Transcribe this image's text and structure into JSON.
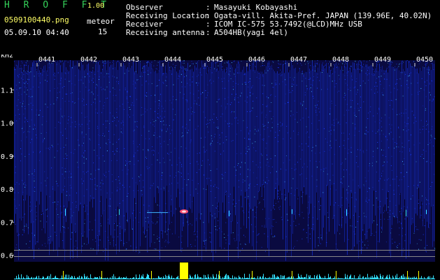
{
  "header": {
    "title": "H R O F F T",
    "version": "1.00",
    "filename": "0509100440.png",
    "datetime": "05.09.10 04:40",
    "meteor_label": "meteor",
    "meteor_count": "15"
  },
  "info": [
    {
      "key": "Observer",
      "value": "Masayuki Kobayashi"
    },
    {
      "key": "Receiving Location",
      "value": "Ogata-vill. Akita-Pref. JAPAN (139.96E, 40.02N)"
    },
    {
      "key": "Receiver",
      "value": "ICOM IC-575 53.7492(@LCD)MHz USB"
    },
    {
      "key": "Receiving antenna",
      "value": "A504HB(yagi 4el)"
    }
  ],
  "spectrogram": {
    "y_unit": "kHz",
    "y_ticks": [
      "1.1",
      "1.0",
      "0.9",
      "0.8",
      "0.7",
      "0.6"
    ],
    "y_values": [
      1.1,
      1.0,
      0.9,
      0.8,
      0.7,
      0.6
    ],
    "time_labels": [
      "0441",
      "0442",
      "0443",
      "0444",
      "0445",
      "0446",
      "0447",
      "0448",
      "0449",
      "0450"
    ],
    "colors": {
      "background": "#0a0a40",
      "noise_primary": "#1a3cff",
      "noise_bright": "#3fb4ff",
      "label_text": "#ffffff",
      "label_green": "#35d25a",
      "level_bar": "#33e0ff",
      "meteor_peak": "#ffff00",
      "echo": "#ff5070"
    }
  }
}
